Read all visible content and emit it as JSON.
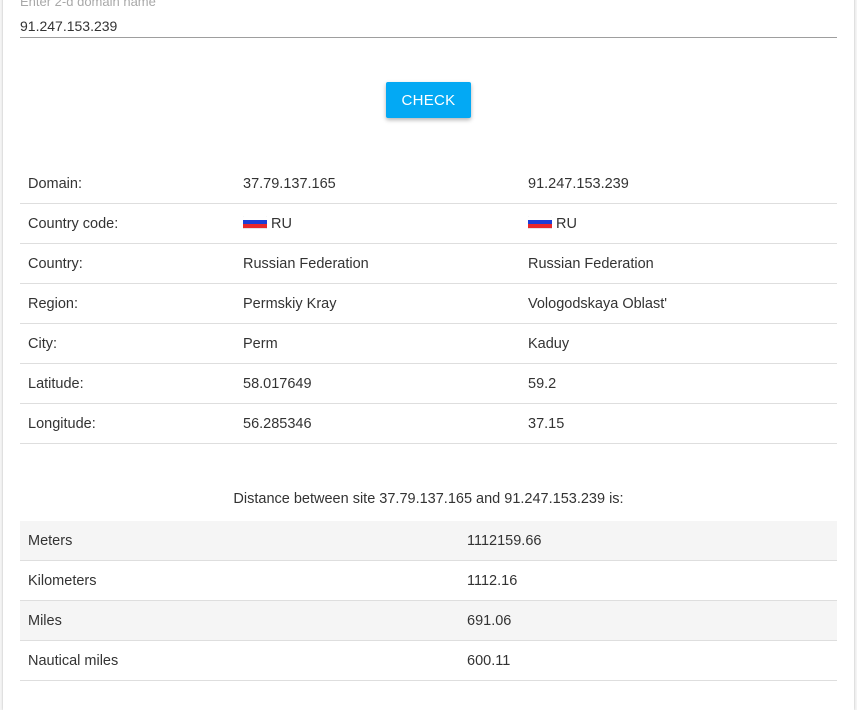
{
  "form": {
    "label": "Enter 2-d domain name",
    "value": "91.247.153.239",
    "check_label": "CHECK"
  },
  "geo_table": {
    "rows": [
      {
        "label": "Domain:",
        "a": "37.79.137.165",
        "b": "91.247.153.239"
      },
      {
        "label": "Country code:",
        "a": "RU",
        "b": "RU",
        "flag": true
      },
      {
        "label": "Country:",
        "a": "Russian Federation",
        "b": "Russian Federation"
      },
      {
        "label": "Region:",
        "a": "Permskiy Kray",
        "b": "Vologodskaya Oblast'"
      },
      {
        "label": "City:",
        "a": "Perm",
        "b": "Kaduy"
      },
      {
        "label": "Latitude:",
        "a": "58.017649",
        "b": "59.2"
      },
      {
        "label": "Longitude:",
        "a": "56.285346",
        "b": "37.15"
      }
    ]
  },
  "distance": {
    "title": "Distance between site 37.79.137.165 and 91.247.153.239 is:",
    "rows": [
      {
        "unit": "Meters",
        "value": "1112159.66"
      },
      {
        "unit": "Kilometers",
        "value": "1112.16"
      },
      {
        "unit": "Miles",
        "value": "691.06"
      },
      {
        "unit": "Nautical miles",
        "value": "600.11"
      }
    ]
  },
  "colors": {
    "accent": "#03a9f4",
    "flag_ru": [
      "#ffffff",
      "#1c3fd6",
      "#e8282b"
    ]
  },
  "icons": {
    "country_flag": "flag-ru-icon"
  }
}
